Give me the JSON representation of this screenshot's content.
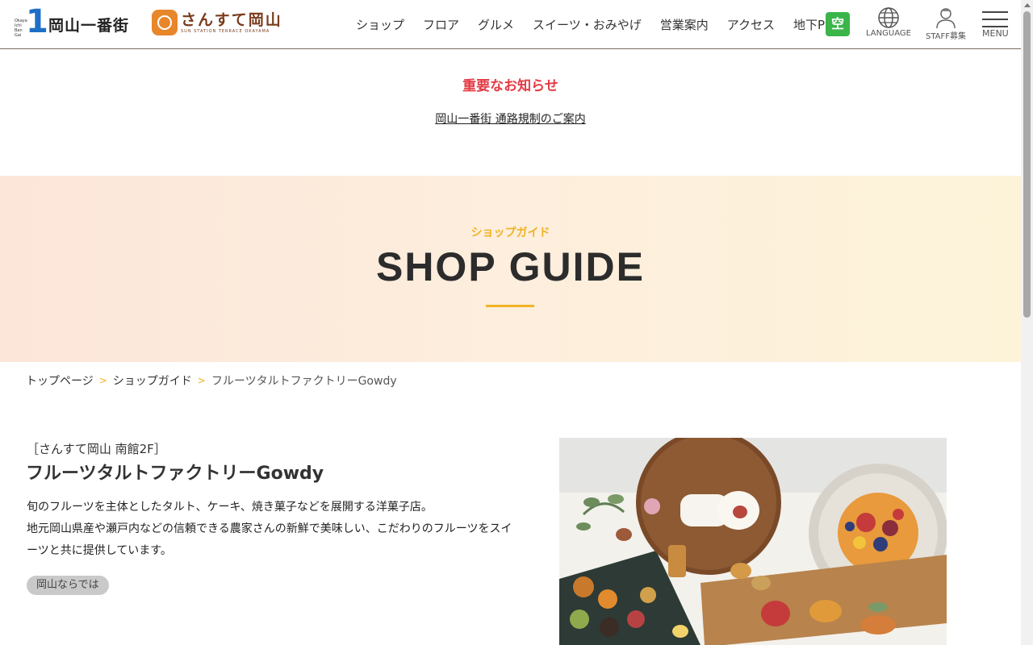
{
  "header": {
    "logo1": {
      "small_text": "Okayama Ichi Ban Gai",
      "numeral": "1",
      "name": "岡山一番街"
    },
    "logo2": {
      "name": "さんすて岡山",
      "sub": "SUN STATION TERRACE OKAYAMA"
    },
    "nav": [
      "ショップ",
      "フロア",
      "グルメ",
      "スイーツ・おみやげ",
      "営業案内",
      "アクセス"
    ],
    "parking": {
      "label": "地下P",
      "status": "空",
      "status_color": "#3bb54a"
    },
    "language_label": "LANGUAGE",
    "staff_label": "STAFF募集",
    "menu_label": "MENU"
  },
  "notice": {
    "title": "重要なお知らせ",
    "link": "岡山一番街 通路規制のご案内",
    "title_color": "#e53a44"
  },
  "hero": {
    "jp": "ショップガイド",
    "en": "SHOP GUIDE",
    "accent_color": "#f0b323"
  },
  "breadcrumb": {
    "items": [
      "トップページ",
      "ショップガイド"
    ],
    "current": "フルーツタルトファクトリーGowdy",
    "separator": ">"
  },
  "shop": {
    "location": "［さんすて岡山 南館2F］",
    "name": "フルーツタルトファクトリーGowdy",
    "description_1": "旬のフルーツを主体としたタルト、ケーキ、焼き菓子などを展開する洋菓子店。",
    "description_2": "地元岡山県産や瀬戸内などの信頼できる農家さんの新鮮で美味しい、こだわりのフルーツをスイーツと共に提供しています。",
    "tag": "岡山ならでは"
  }
}
